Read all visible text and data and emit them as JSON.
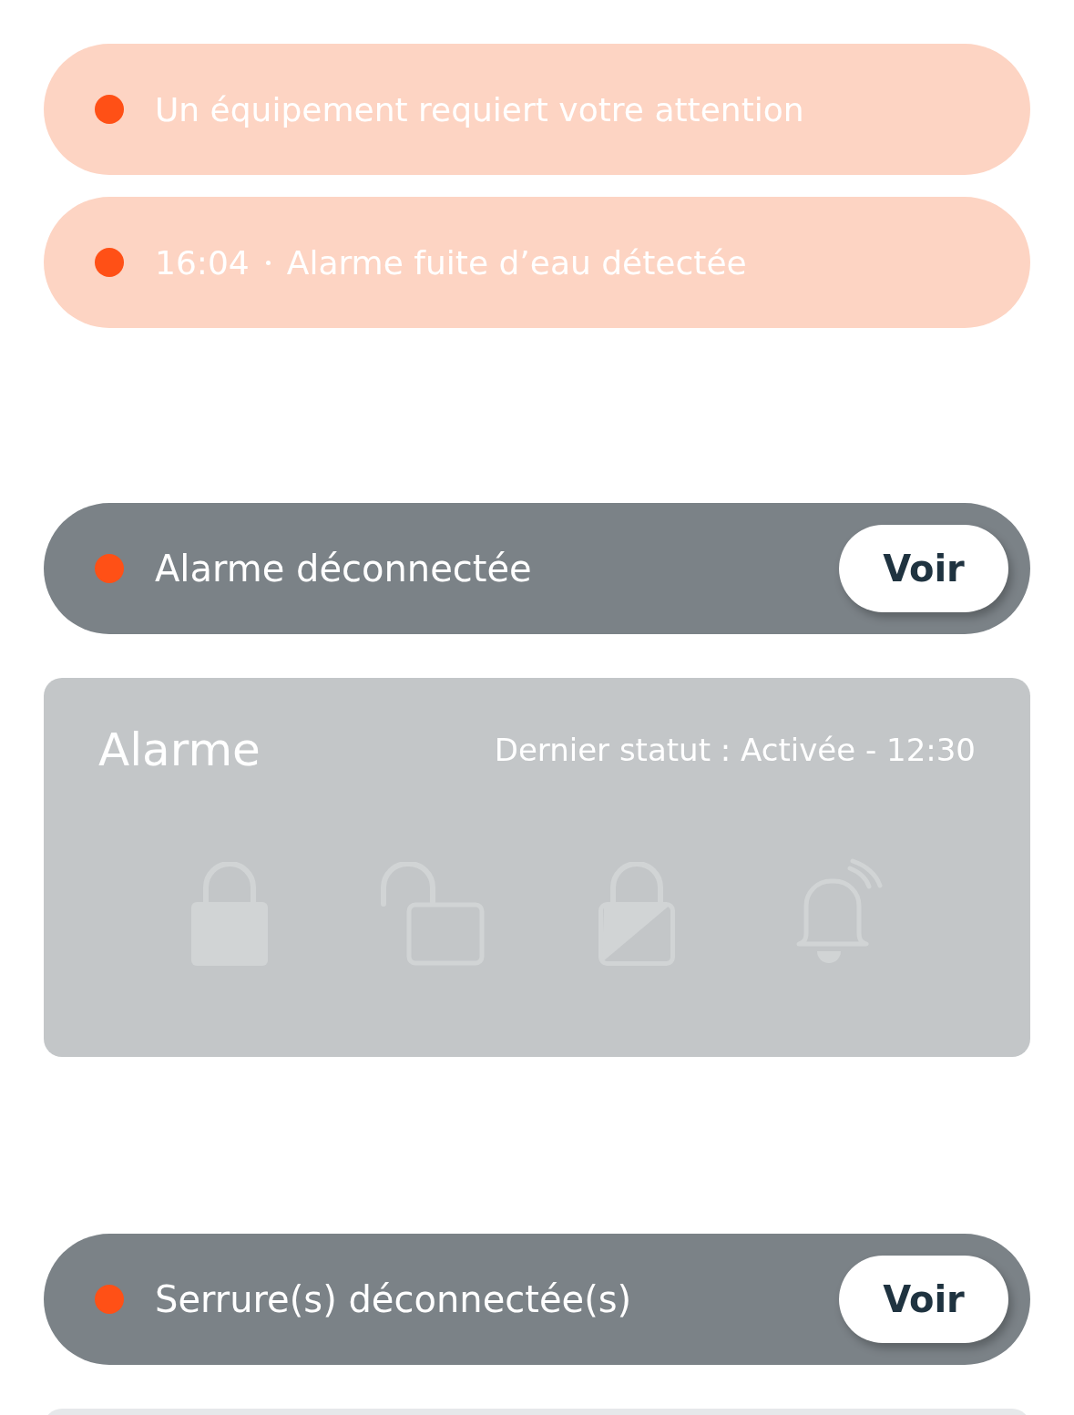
{
  "alerts": [
    {
      "text": "Un équipement requiert votre attention",
      "color": "#ff5016"
    },
    {
      "time": "16:04",
      "text": "Alarme fuite d’eau détectée",
      "color": "#ff5016"
    }
  ],
  "sections": [
    {
      "banner": {
        "text": "Alarme déconnectée",
        "color": "#ff5016",
        "button": "Voir"
      },
      "card": {
        "kind": "device",
        "disabled": true,
        "title": "Alarme",
        "status": "Dernier statut : Activée - 12:30",
        "actions": [
          {
            "kind": "lock"
          },
          {
            "kind": "unlock"
          },
          {
            "kind": "partial"
          },
          {
            "kind": "siren"
          }
        ]
      }
    },
    {
      "banner": {
        "text": "Serrure(s) déconnectée(s)",
        "color": "#ff5016",
        "button": "Voir"
      },
      "card": {
        "kind": "cut"
      }
    }
  ]
}
